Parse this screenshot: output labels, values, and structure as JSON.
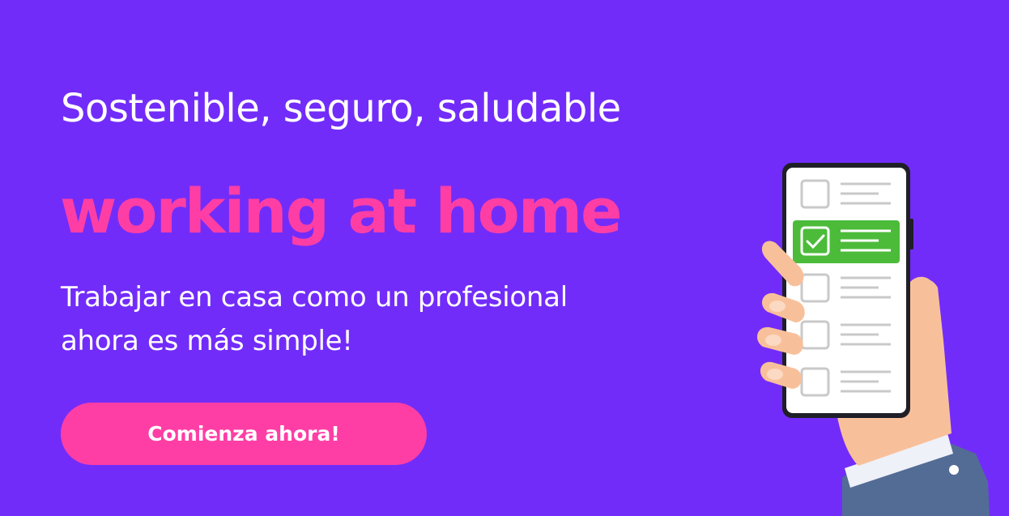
{
  "banner": {
    "subtitle": "Sostenible, seguro, saludable",
    "headline": "working at home",
    "description_lines": [
      "Trabajar en casa como un profesional",
      "ahora es más simple!"
    ],
    "cta_label": "Comienza ahora!"
  },
  "checklist": {
    "item_count": 5,
    "checked_index": 1
  },
  "colors": {
    "background": "#722CF9",
    "accent_pink": "#FF3EA5",
    "text_white": "#FFFFFF",
    "check_green": "#4CBB3A",
    "sleeve_blue": "#536C95",
    "skin": "#F8C09A"
  },
  "icons": {
    "phone": "smartphone-checklist-icon",
    "hand": "hand-icon",
    "check": "checkmark-icon"
  }
}
